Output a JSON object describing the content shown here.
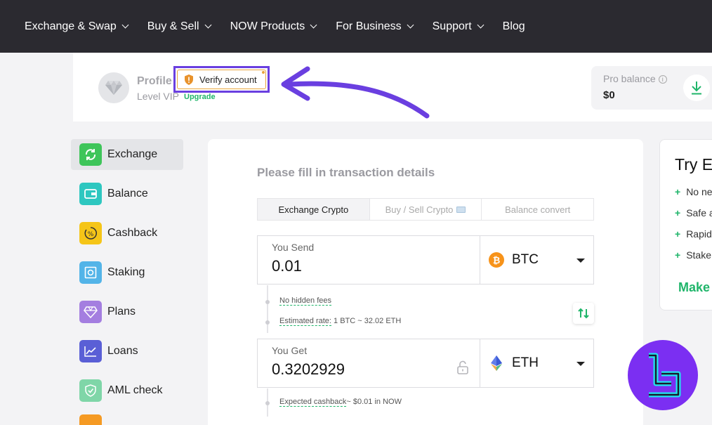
{
  "nav": {
    "items": [
      {
        "label": "Exchange & Swap",
        "has_dropdown": true
      },
      {
        "label": "Buy & Sell",
        "has_dropdown": true
      },
      {
        "label": "NOW Products",
        "has_dropdown": true
      },
      {
        "label": "For Business",
        "has_dropdown": true
      },
      {
        "label": "Support",
        "has_dropdown": true
      },
      {
        "label": "Blog",
        "has_dropdown": false
      }
    ]
  },
  "profile": {
    "name": "Profile",
    "level_prefix": "Level",
    "level": "VIP",
    "upgrade_label": "Upgrade",
    "verify_label": "Verify account",
    "avatar_icon": "diamond-icon"
  },
  "pro_balance": {
    "label": "Pro balance",
    "info_glyph": "i",
    "value": "$0"
  },
  "sidebar": {
    "items": [
      {
        "label": "Exchange",
        "icon": "exchange-icon",
        "color": "#3ec55a",
        "active": true
      },
      {
        "label": "Balance",
        "icon": "wallet-icon",
        "color": "#2ec7c0",
        "active": false
      },
      {
        "label": "Cashback",
        "icon": "cashback-icon",
        "color": "#f5c518",
        "active": false
      },
      {
        "label": "Staking",
        "icon": "safe-icon",
        "color": "#53b4e8",
        "active": false
      },
      {
        "label": "Plans",
        "icon": "diamond-icon",
        "color": "#a47ee0",
        "active": false
      },
      {
        "label": "Loans",
        "icon": "chart-icon",
        "color": "#5a5fd6",
        "active": false
      },
      {
        "label": "AML check",
        "icon": "shield-check-icon",
        "color": "#7fd6a8",
        "active": false
      }
    ]
  },
  "exchange": {
    "title": "Please fill in transaction details",
    "tabs": [
      {
        "label": "Exchange Crypto",
        "active": true
      },
      {
        "label": "Buy / Sell Crypto",
        "active": false
      },
      {
        "label": "Balance convert",
        "active": false
      }
    ],
    "send": {
      "label": "You Send",
      "value": "0.01",
      "coin": "BTC"
    },
    "get": {
      "label": "You Get",
      "value": "0.3202929",
      "coin": "ETH"
    },
    "no_fees": "No hidden fees",
    "estimated_label": "Estimated rate:",
    "estimated_value": "1 BTC ~ 32.02 ETH",
    "cashback_label": "Expected cashback",
    "cashback_value": "~ $0.01 in NOW"
  },
  "promo": {
    "title": "Try E",
    "items": [
      "No ne",
      "Safe a",
      "Rapid",
      "Stake"
    ],
    "cta": "Make"
  },
  "colors": {
    "accent_green": "#1fb56a",
    "highlight_purple": "#6a3fe0",
    "verify_orange": "#e8a33b",
    "nav_bg": "#2b2a30"
  }
}
